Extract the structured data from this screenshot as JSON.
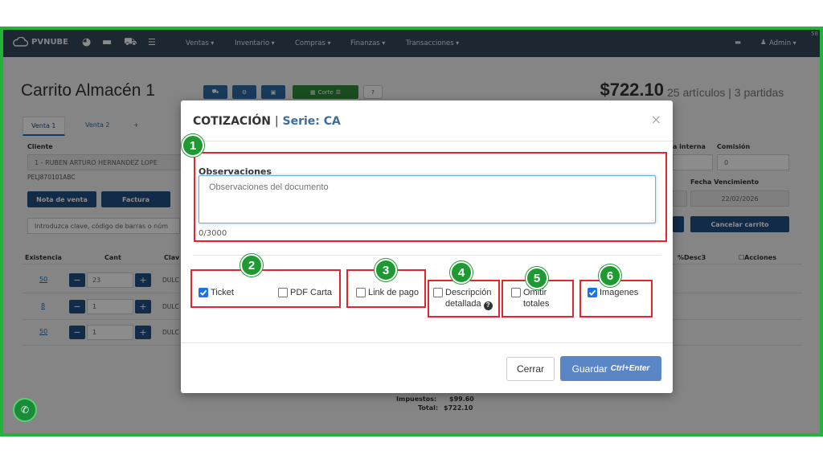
{
  "app": {
    "logo_text": "PVNUBE",
    "version": "58"
  },
  "nav": {
    "menus": [
      "Ventas",
      "Inventario",
      "Compras",
      "Finanzas",
      "Transacciones"
    ],
    "admin": "Admin"
  },
  "background": {
    "page_title": "Carrito Almacén 1",
    "toolbar_corte": "Corte",
    "total": "$722.10",
    "total_sub": "25 artículos | 3 partidas",
    "tabs": [
      "Venta 1",
      "Venta 2",
      "+"
    ],
    "client_label": "Cliente",
    "client_name": "1 - RUBEN ARTURO HERNANDEZ LOPE",
    "client_rfc": "PELJ870101ABC",
    "btn_nota": "Nota de venta",
    "btn_factura": "Factura",
    "search_placeholder": "Introduzca clave, código de barras o núm",
    "nota_interna": "a interna",
    "comision_label": "Comisión",
    "comision_value": "0",
    "fecha_venc_label": "Fecha Vencimiento",
    "fecha_venc_value": "22/02/2026",
    "btn_cancelar": "Cancelar carrito",
    "col_existencia": "Existencia",
    "col_cant": "Cant",
    "col_clave": "Clav",
    "col_desc3": "%Desc3",
    "col_acciones": "Acciones",
    "rows": [
      {
        "existencia": "50",
        "cant": "23",
        "clave": "DULC"
      },
      {
        "existencia": "8",
        "cant": "1",
        "clave": "DULC"
      },
      {
        "existencia": "50",
        "cant": "1",
        "clave": "DULC"
      }
    ],
    "impuestos_label": "Impuestos:",
    "impuestos_value": "$99.60",
    "total_label": "Total:",
    "total_value": "$722.10"
  },
  "modal": {
    "title": "COTIZACIÓN",
    "separator": "|",
    "serie": "Serie: CA",
    "close_symbol": "×",
    "obs_label": "Observaciones",
    "obs_placeholder": "Observaciones del documento",
    "obs_count": "0/3000",
    "options": {
      "ticket": "Ticket",
      "pdf_carta": "PDF Carta",
      "link_pago": "Link de pago",
      "desc_line1": "Descripción",
      "desc_line2": "detallada",
      "omitir_line1": "Omitir",
      "omitir_line2": "totales",
      "imagenes": "Imagenes"
    },
    "btn_cerrar": "Cerrar",
    "btn_guardar": "Guardar",
    "btn_guardar_shortcut": "Ctrl+Enter"
  },
  "annotations": [
    "1",
    "2",
    "3",
    "4",
    "5",
    "6"
  ],
  "colors": {
    "frame": "#22b33a",
    "navbar": "#33475b",
    "highlight": "#e1262d",
    "badge": "#1f9a32",
    "primary": "#5b86c6"
  }
}
